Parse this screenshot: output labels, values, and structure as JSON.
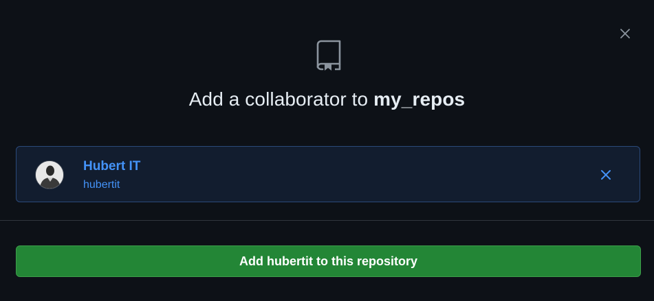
{
  "dialog": {
    "title_prefix": "Add a collaborator to",
    "repo_name": "my_repos",
    "close_icon": "close-icon",
    "header_icon": "repo-icon"
  },
  "selected_user": {
    "name": "Hubert IT",
    "login": "hubertit",
    "avatar_icon": "avatar",
    "remove_icon": "close-icon"
  },
  "actions": {
    "add_button_label": "Add hubertit to this repository"
  },
  "colors": {
    "background": "#0d1117",
    "card_background": "#121d2f",
    "card_border": "#2b4a7a",
    "link_blue": "#4493f8",
    "primary_green": "#238636",
    "text": "#e6edf3",
    "muted_icon": "#8b949e"
  }
}
